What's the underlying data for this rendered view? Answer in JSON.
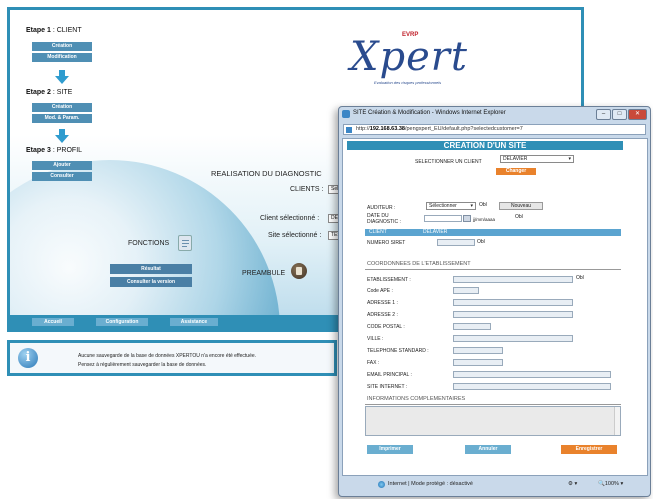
{
  "main": {
    "steps": [
      {
        "title": "Etape 1",
        "subtitle": "CLIENT",
        "buttons": [
          "Création",
          "Modification"
        ]
      },
      {
        "title": "Etape 2",
        "subtitle": "SITE",
        "buttons": [
          "Création",
          "Mod. & Param."
        ]
      },
      {
        "title": "Etape 3",
        "subtitle": "PROFIL",
        "buttons": [
          "Ajouter",
          "Consulter"
        ]
      }
    ],
    "logo": {
      "word": "Xpert",
      "badge": "EVRP",
      "tagline": "Evaluation des risques professionnels"
    },
    "diagnostic_title": "REALISATION DU DIAGNOSTIC",
    "clients_label": "CLIENTS :",
    "clients_value": "Sele",
    "client_selected_label": "Client sélectionné :",
    "client_selected_value": "DELAV",
    "site_selected_label": "Site sélectionné :",
    "site_selected_value": "TEST",
    "fonctions_label": "FONCTIONS",
    "fn_buttons": [
      "Résultat",
      "Consulter la version"
    ],
    "preambule_label": "PREAMBULE",
    "bottom_buttons": [
      "Accueil",
      "Configuration",
      "Assistance"
    ]
  },
  "info": {
    "line1": "Aucune sauvegarde de la base de données XPERTOU n'a encore été effectuée.",
    "line2": "Pensez à régulièrement sauvegarder la base de données."
  },
  "ie": {
    "title": "SITE Création & Modification - Windows Internet Explorer",
    "url_prefix": "http://",
    "url_host": "192.168.63.38",
    "url_path": "/pengxpert_EU/default.php?selectedcustomer=7",
    "status": "Internet | Mode protégé : désactivé",
    "zoom": "100%",
    "controls": {
      "minimize": "–",
      "maximize": "□",
      "close": "✕"
    }
  },
  "form": {
    "header": "CREATION D'UN SITE",
    "select_client_label": "SELECTIONNER UN CLIENT",
    "select_client_value": "DELAVIER",
    "changer": "Changer",
    "auditeur_label": "AUDITEUR :",
    "auditeur_value": "Sélectionner",
    "nouveau": "Nouveau",
    "date_label_1": "DATE DU",
    "date_label_2": "DIAGNOSTIC :",
    "date_format": "jj/mm/aaaa",
    "client_bar_label": "CLIENT",
    "client_bar_value": "DELAVIER",
    "siret_label": "NUMERO SIRET",
    "coord_section": "COORDONNEES DE L'ETABLISSEMENT",
    "fields": [
      "ETABLISSEMENT :",
      "Code APE :",
      "ADRESSE 1 :",
      "ADRESSE 2 :",
      "CODE POSTAL :",
      "VILLE :",
      "TELEPHONE STANDARD :",
      "FAX :",
      "EMAIL PRINCIPAL :",
      "SITE INTERNET :"
    ],
    "info_section": "INFORMATIONS COMPLEMENTAIRES",
    "buttons": {
      "imprimer": "Imprimer",
      "annuler": "Annuler",
      "enregistrer": "Enregistrer"
    },
    "required_mark": "Obl"
  },
  "colors": {
    "frame": "#2f8fb6",
    "nav_button": "#4f8fb4",
    "accent_orange": "#e9822c"
  }
}
